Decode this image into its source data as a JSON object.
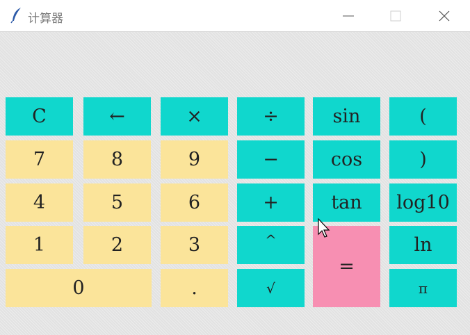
{
  "window": {
    "title": "计算器"
  },
  "keys": {
    "clear": "C",
    "backspace": "←",
    "multiply": "×",
    "divide": "÷",
    "sin": "sin",
    "lparen": "(",
    "seven": "7",
    "eight": "8",
    "nine": "9",
    "minus": "−",
    "cos": "cos",
    "rparen": ")",
    "four": "4",
    "five": "5",
    "six": "6",
    "plus": "+",
    "tan": "tan",
    "log10": "log10",
    "one": "1",
    "two": "2",
    "three": "3",
    "power": "^",
    "equals": "=",
    "ln": "ln",
    "zero": "0",
    "dot": ".",
    "sqrt": "√",
    "pi": "π"
  },
  "colors": {
    "operator": "#10d7cd",
    "number": "#fbe49a",
    "equals": "#f78fb2"
  }
}
